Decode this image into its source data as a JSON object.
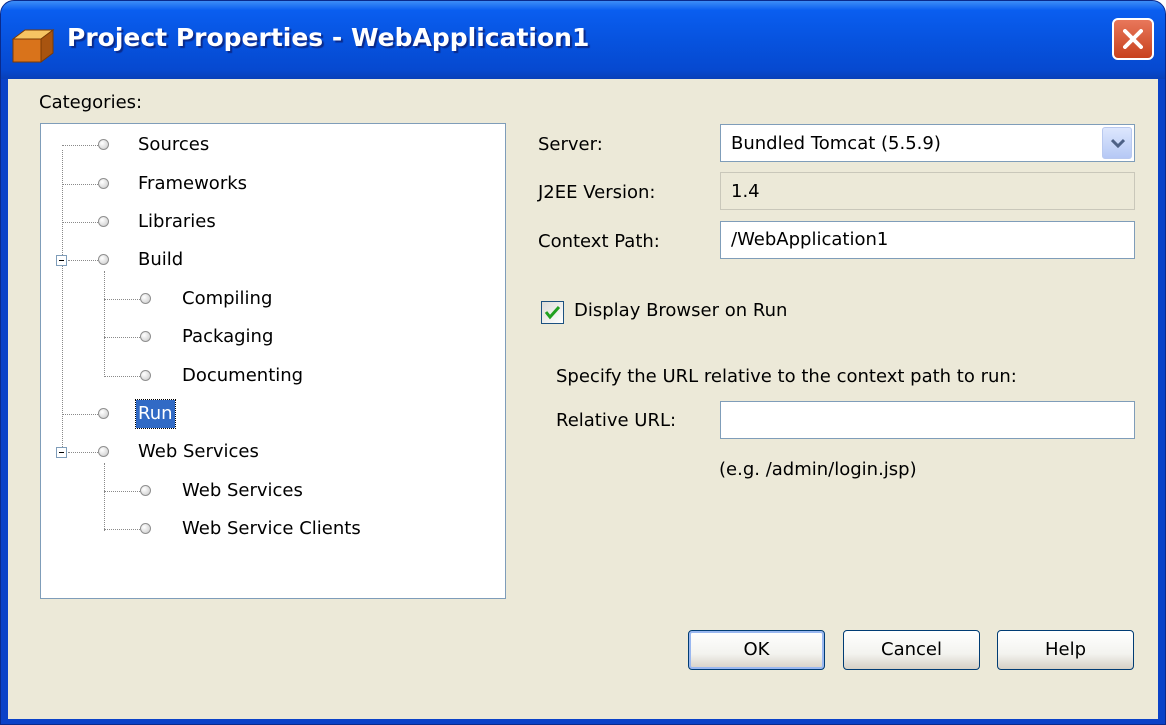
{
  "window": {
    "title": "Project Properties - WebApplication1",
    "colors": {
      "titlebar": "#0a5ef0",
      "client_background": "#ece9d8",
      "selection": "#316ac5",
      "close_button": "#d5522e",
      "checkmark": "#21a121"
    }
  },
  "categories": {
    "label": "Categories:",
    "items": [
      {
        "label": "Sources",
        "depth": 0
      },
      {
        "label": "Frameworks",
        "depth": 0
      },
      {
        "label": "Libraries",
        "depth": 0
      },
      {
        "label": "Build",
        "depth": 0,
        "expanded": true
      },
      {
        "label": "Compiling",
        "depth": 1
      },
      {
        "label": "Packaging",
        "depth": 1
      },
      {
        "label": "Documenting",
        "depth": 1
      },
      {
        "label": "Run",
        "depth": 0,
        "selected": true
      },
      {
        "label": "Web Services",
        "depth": 0,
        "expanded": true
      },
      {
        "label": "Web Services",
        "depth": 1
      },
      {
        "label": "Web Service Clients",
        "depth": 1
      }
    ]
  },
  "run_panel": {
    "server_label": "Server:",
    "server_value": "Bundled Tomcat (5.5.9)",
    "j2ee_label": "J2EE Version:",
    "j2ee_value": "1.4",
    "context_label": "Context Path:",
    "context_value": "/WebApplication1",
    "display_browser_label": "Display Browser on Run",
    "display_browser_checked": true,
    "hint": "Specify the URL relative to the context path to run:",
    "relative_label": "Relative URL:",
    "relative_value": "",
    "example": "(e.g. /admin/login.jsp)"
  },
  "buttons": {
    "ok": "OK",
    "cancel": "Cancel",
    "help": "Help"
  },
  "icons": {
    "app": "project-box-icon",
    "close": "close-x-icon",
    "combo": "chevron-down-icon",
    "check": "checkmark-icon",
    "tree_node": "bullet-icon",
    "tree_expander": "collapse-minus-icon"
  }
}
